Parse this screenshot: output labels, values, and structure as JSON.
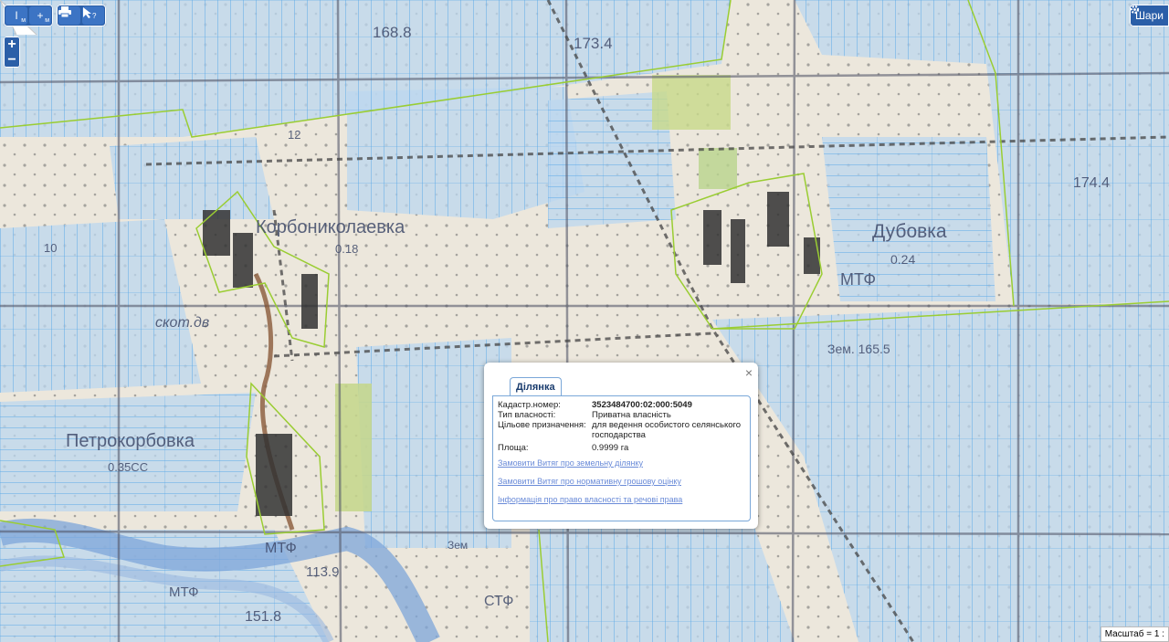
{
  "toolbar": {
    "measure_distance_label": "I",
    "measure_distance_unit": "м",
    "measure_area_label": "+",
    "measure_area_unit": "м",
    "print_icon": "printer-icon",
    "identify_icon": "cursor-question-icon"
  },
  "zoom": {
    "in": "+",
    "out": "−"
  },
  "layers": {
    "icon": "gear-icon",
    "label": "Шари"
  },
  "scale": {
    "text": "Масштаб = 1 :"
  },
  "map_labels": {
    "korbonikolaevka": "Корбониколаевка",
    "dubovka": "Дубовка",
    "petrokorbovka": "Петрокорбовка",
    "skot_dv": "скот.дв",
    "mtf1": "МТФ",
    "mtf2": "МТФ",
    "mtf3": "МТФ",
    "elev1": "168.8",
    "elev2": "173.4",
    "elev3": "174.4",
    "elev4": "151.8",
    "elev5": "113.9",
    "zem": "Зем. 165.5",
    "zem2": "Зем",
    "num018": "0.18",
    "num024": "0.24",
    "num035": "0.35СС",
    "num12": "12",
    "num10": "10",
    "stf": "СТФ"
  },
  "popup": {
    "tab": "Ділянка",
    "close": "×",
    "fields": {
      "cadastre_label": "Кадастр.номер:",
      "cadastre_value": "3523484700:02:000:5049",
      "ownership_label": "Тип власності:",
      "ownership_value": "Приватна власність",
      "purpose_label": "Цільове призначення:",
      "purpose_value": "для ведення особистого селянського господарства",
      "area_label": "Площа:",
      "area_value": "0.9999 га"
    },
    "links": {
      "extract": "Замовити Витяг про земельну ділянку",
      "valuation": "Замовити Витяг про нормативну грошову оцінку",
      "rights": "Інформація про право власності та речові права"
    }
  },
  "colors": {
    "parcel_fill": "#bcd6ee",
    "parcel_stroke": "#5aa8e8",
    "boundary": "#9acd32",
    "ui_blue": "#2b5fa8",
    "link": "#6a8bd8"
  }
}
